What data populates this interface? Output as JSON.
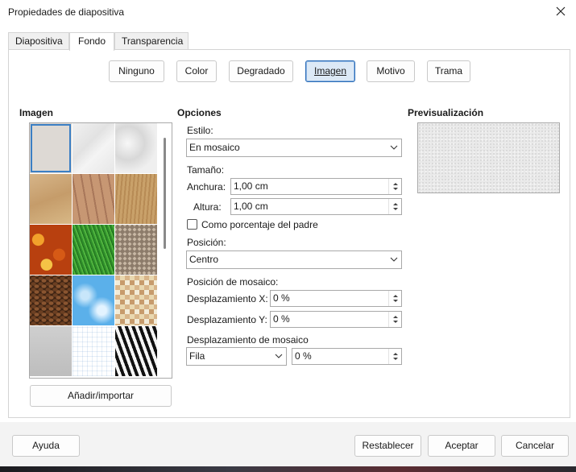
{
  "window": {
    "title": "Propiedades de diapositiva"
  },
  "tabs": [
    {
      "label": "Diapositiva",
      "active": false
    },
    {
      "label": "Fondo",
      "active": true
    },
    {
      "label": "Transparencia",
      "active": false
    }
  ],
  "fill_types": [
    {
      "label": "Ninguno",
      "active": false
    },
    {
      "label": "Color",
      "active": false
    },
    {
      "label": "Degradado",
      "active": false
    },
    {
      "label": "Imagen",
      "active": true
    },
    {
      "label": "Motivo",
      "active": false
    },
    {
      "label": "Trama",
      "active": false
    }
  ],
  "image_section": {
    "heading": "Imagen",
    "add_button": "Añadir/importar",
    "thumbnails": [
      "plain-gray",
      "white-crumpled",
      "white-marble",
      "sand",
      "wood-planks",
      "wood-grain",
      "autumn-leaves",
      "green-grass",
      "pebbles",
      "coffee-beans",
      "blue-sky",
      "color-squares",
      "concrete",
      "graph-paper",
      "zebra"
    ],
    "selected_index": 0
  },
  "options": {
    "heading": "Opciones",
    "style_label": "Estilo:",
    "style_value": "En mosaico",
    "size_label": "Tamaño:",
    "width_label": "Anchura:",
    "width_value": "1,00 cm",
    "height_label": "Altura:",
    "height_value": "1,00 cm",
    "relative_label": "Como porcentaje del padre",
    "relative_checked": false,
    "position_label": "Posición:",
    "position_value": "Centro",
    "tile_position_label": "Posición de mosaico:",
    "offset_x_label": "Desplazamiento X:",
    "offset_x_value": "0 %",
    "offset_y_label": "Desplazamiento Y:",
    "offset_y_value": "0 %",
    "tile_offset_label": "Desplazamiento de mosaico",
    "tile_offset_mode": "Fila",
    "tile_offset_value": "0 %"
  },
  "preview": {
    "heading": "Previsualización"
  },
  "footer": {
    "help": "Ayuda",
    "reset": "Restablecer",
    "ok": "Aceptar",
    "cancel": "Cancelar"
  },
  "colors": {
    "accent": "#2b6cb7",
    "selected_fill": "#dce9f6"
  }
}
